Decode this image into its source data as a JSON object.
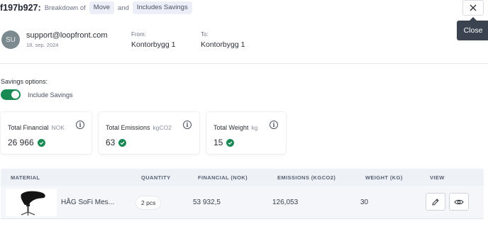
{
  "header": {
    "id": "f197b927:",
    "breakdown_label": "Breakdown of",
    "chip_move": "Move",
    "and_label": "and",
    "chip_savings": "Includes Savings",
    "close_tooltip": "Close"
  },
  "user": {
    "initials": "SU",
    "email": "support@loopfront.com",
    "date": "18. sep. 2024"
  },
  "route": {
    "from_label": "From:",
    "from_value": "Kontorbygg 1",
    "to_label": "To:",
    "to_value": "Kontorbygg 1"
  },
  "savings": {
    "title": "Savings options:",
    "toggle_label": "Include Savings",
    "toggle_on": true
  },
  "cards": [
    {
      "label": "Total Financial",
      "unit": "NOK",
      "value": "26 966"
    },
    {
      "label": "Total Emissions",
      "unit": "kgCO2",
      "value": "63"
    },
    {
      "label": "Total Weight",
      "unit": "kg",
      "value": "15"
    }
  ],
  "table": {
    "headers": [
      "MATERIAL",
      "QUANTITY",
      "FINANCIAL (NOK)",
      "EMISSIONS (KGCO2)",
      "WEIGHT (KG)",
      "VIEW"
    ],
    "rows": [
      {
        "material": "HÅG SoFi Mes...",
        "quantity": "2 pcs",
        "financial": "53 932,5",
        "emissions": "126,053",
        "weight": "30"
      }
    ]
  },
  "icons": {
    "close": "close-icon",
    "info": "info-icon",
    "check": "check-circle-icon",
    "edit": "pencil-icon",
    "view": "eye-icon"
  },
  "colors": {
    "accent_green": "#1a8a55",
    "tooltip_bg": "#3b4350",
    "chip_bg": "#eceef8",
    "table_header_bg": "#eef1f6"
  }
}
